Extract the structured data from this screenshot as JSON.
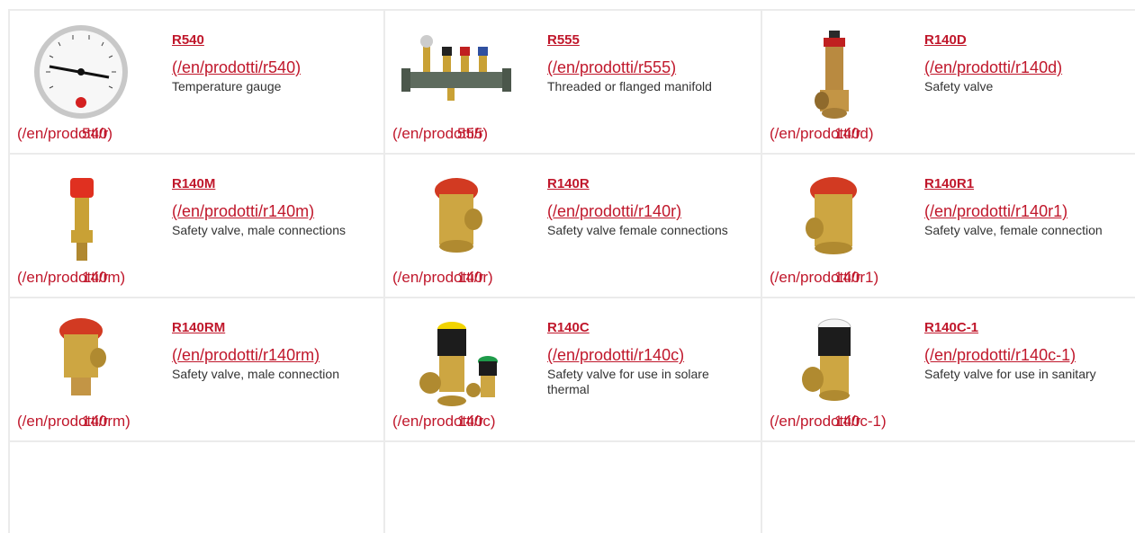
{
  "products": [
    {
      "code": "R540",
      "url": "(/en/prodotti/r540)",
      "desc": "Temperature gauge",
      "img_path": "(/en/prodotti/r",
      "img_alt": "540)",
      "icon": "temperature-gauge-icon"
    },
    {
      "code": "R555",
      "url": "(/en/prodotti/r555)",
      "desc": "Threaded or flanged manifold",
      "img_path": "(/en/prodotti/r",
      "img_alt": "555)",
      "icon": "manifold-icon"
    },
    {
      "code": "R140D",
      "url": "(/en/prodotti/r140d)",
      "desc": "Safety valve",
      "img_path": "(/en/prodotti/r",
      "img_alt": "140d)",
      "icon": "safety-valve-icon"
    },
    {
      "code": "R140M",
      "url": "(/en/prodotti/r140m)",
      "desc": "Safety valve, male connections",
      "img_path": "(/en/prodotti/r",
      "img_alt": "140m)",
      "icon": "safety-valve-male-icon"
    },
    {
      "code": "R140R",
      "url": "(/en/prodotti/r140r)",
      "desc": "Safety valve female connections",
      "img_path": "(/en/prodotti/r",
      "img_alt": "140r)",
      "icon": "safety-valve-female-icon"
    },
    {
      "code": "R140R1",
      "url": "(/en/prodotti/r140r1)",
      "desc": "Safety valve, female connection",
      "img_path": "(/en/prodotti/r",
      "img_alt": "140r1)",
      "icon": "safety-valve-female-icon"
    },
    {
      "code": "R140RM",
      "url": "(/en/prodotti/r140rm)",
      "desc": "Safety valve, male connection",
      "img_path": "(/en/prodotti/r",
      "img_alt": "140rm)",
      "icon": "safety-valve-male-icon"
    },
    {
      "code": "R140C",
      "url": "(/en/prodotti/r140c)",
      "desc": "Safety valve for use in solare thermal",
      "img_path": "(/en/prodotti/r",
      "img_alt": "140c)",
      "icon": "solar-safety-valve-icon"
    },
    {
      "code": "R140C-1",
      "url": "(/en/prodotti/r140c-1)",
      "desc": "Safety valve for use in sanitary",
      "img_path": "(/en/prodotti/r",
      "img_alt": "140c-1)",
      "icon": "sanitary-safety-valve-icon"
    }
  ]
}
